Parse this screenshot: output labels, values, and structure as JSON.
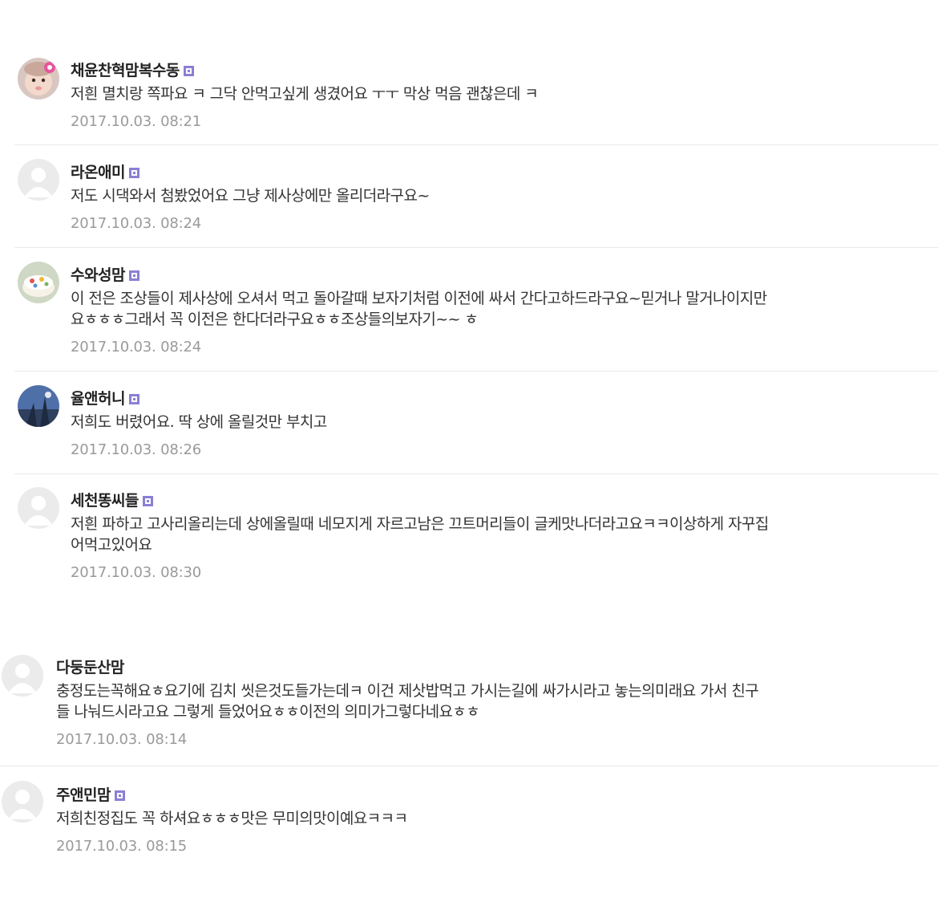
{
  "colors": {
    "nickname": "#222222",
    "text": "#333333",
    "date": "#9a9a9a",
    "divider": "#e9e9e9",
    "level_badge": "#8a7fd6",
    "default_avatar_bg": "#ebebeb",
    "default_avatar_fg": "#ffffff"
  },
  "comments": [
    {
      "nickname": "채윤찬혁맘복수동",
      "level_icon": "level-badge-icon",
      "avatar_icon": "baby-photo-avatar-icon",
      "lines": [
        "저흰 멸치랑 쪽파요 ㅋ 그닥 안먹고싶게 생겼어요 ㅜㅜ 막상 먹음 괜찮은데 ㅋ"
      ],
      "date": "2017.10.03. 08:21"
    },
    {
      "nickname": "라온애미",
      "level_icon": "level-badge-icon",
      "avatar_icon": "default-user-icon",
      "lines": [
        "저도 시댁와서 첨봤었어요 그냥 제사상에만 올리더라구요~"
      ],
      "date": "2017.10.03. 08:24"
    },
    {
      "nickname": "수와성맘",
      "level_icon": "level-badge-icon",
      "avatar_icon": "cake-photo-avatar-icon",
      "lines": [
        "이 전은 조상들이 제사상에 오셔서 먹고 돌아갈때 보자기처럼 이전에 싸서 간다고하드라구요~믿거나 말거나이지만",
        "요ㅎㅎㅎ그래서 꼭 이전은 한다더라구요ㅎㅎ조상들의보자기~~ ㅎ"
      ],
      "date": "2017.10.03. 08:24"
    },
    {
      "nickname": "율앤허니",
      "level_icon": "level-badge-icon",
      "avatar_icon": "sky-photo-avatar-icon",
      "lines": [
        "저희도 버렸어요. 딱 상에 올릴것만 부치고"
      ],
      "date": "2017.10.03. 08:26"
    },
    {
      "nickname": "세천똥씨들",
      "level_icon": "level-badge-icon",
      "avatar_icon": "default-user-icon",
      "lines": [
        "저흰 파하고 고사리올리는데 상에올릴때 네모지게 자르고남은 끄트머리들이 글케맛나더라고요ㅋㅋ이상하게 자꾸집",
        "어먹고있어요"
      ],
      "date": "2017.10.03. 08:30"
    },
    {
      "nickname": "다둥둔산맘",
      "level_icon": "",
      "avatar_icon": "default-user-icon",
      "lines": [
        "충정도는꼭해요ㅎ요기에 김치 씻은것도들가는데ㅋ 이건 제삿밥먹고 가시는길에 싸가시라고 놓는의미래요 가서 친구",
        "들 나눠드시라고요 그렇게 들었어요ㅎㅎ이전의 의미가그렇다네요ㅎㅎ"
      ],
      "date": "2017.10.03. 08:14"
    },
    {
      "nickname": "주앤민맘",
      "level_icon": "level-badge-icon",
      "avatar_icon": "default-user-icon",
      "lines": [
        "저희친정집도 꼭 하셔요ㅎㅎㅎ맛은 무미의맛이예요ㅋㅋㅋ"
      ],
      "date": "2017.10.03. 08:15"
    }
  ]
}
